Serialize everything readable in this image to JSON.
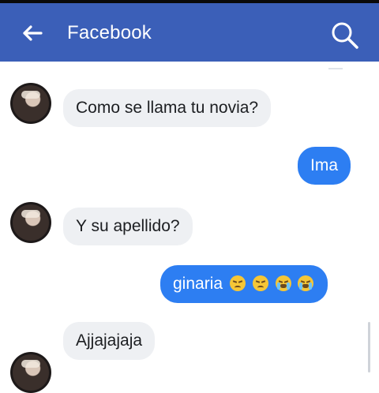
{
  "header": {
    "title": "Facebook",
    "back_icon": "back-arrow-icon",
    "search_icon": "search-icon",
    "color": "#3b5fb8"
  },
  "messages": [
    {
      "from": "them",
      "text": "Como se llama tu novia?"
    },
    {
      "from": "me",
      "text": "Ima"
    },
    {
      "from": "them",
      "text": "Y su apellido?"
    },
    {
      "from": "me",
      "text": "ginaria",
      "emojis": [
        "disappointed-face-icon",
        "disappointed-face-icon",
        "crying-face-icon",
        "crying-face-icon"
      ]
    },
    {
      "from": "them",
      "text": "Ajjajajaja"
    }
  ],
  "colors": {
    "incoming_bubble": "#eef0f3",
    "outgoing_bubble": "#2d7ef2"
  }
}
